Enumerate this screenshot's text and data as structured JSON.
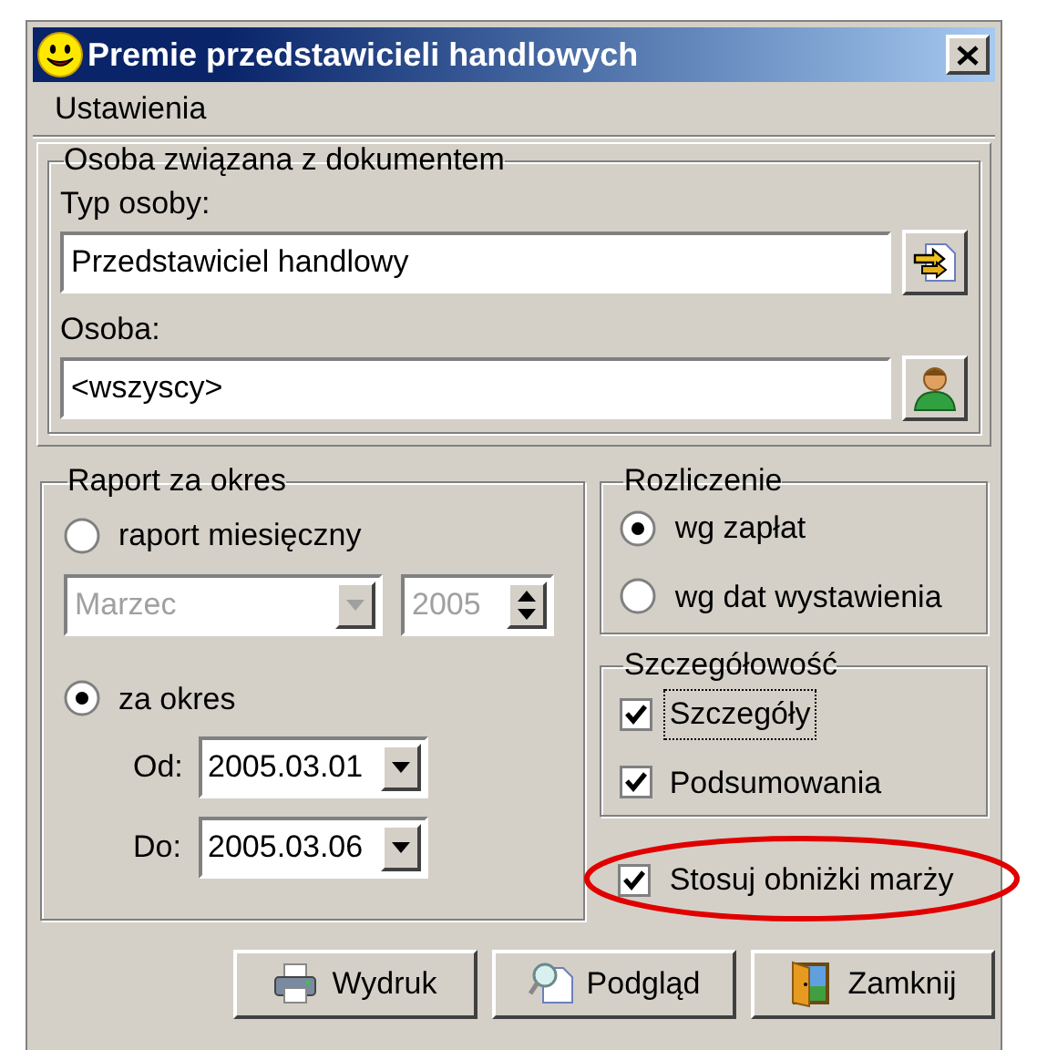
{
  "window": {
    "title": "Premie przedstawicieli handlowych"
  },
  "menu": [
    "Ustawienia"
  ],
  "person_group": {
    "title": "Osoba związana z dokumentem",
    "fields": [
      {
        "label": "Typ osoby:",
        "value": "Przedstawiciel handlowy",
        "kind": "swap"
      },
      {
        "label": "Osoba:",
        "value": "<wszyscy>",
        "kind": "person"
      }
    ]
  },
  "period_group": {
    "title": "Raport za okres",
    "options": [
      {
        "label": "raport miesięczny",
        "selected": false
      },
      {
        "label": "za okres",
        "selected": true
      }
    ],
    "month": {
      "value": "Marzec",
      "disabled": true
    },
    "year": {
      "value": "2005",
      "disabled": true
    },
    "dates": [
      {
        "label": "Od:",
        "value": "2005.03.01"
      },
      {
        "label": "Do:",
        "value": "2005.03.06"
      }
    ]
  },
  "settlement_group": {
    "title": "Rozliczenie",
    "options": [
      {
        "label": "wg zapłat",
        "selected": true
      },
      {
        "label": "wg dat wystawienia",
        "selected": false
      }
    ]
  },
  "detail_group": {
    "title": "Szczegółowość",
    "options": [
      {
        "label": "Szczegóły",
        "checked": true,
        "focused": true
      },
      {
        "label": "Podsumowania",
        "checked": true,
        "focused": false
      }
    ]
  },
  "margin_option": {
    "label": "Stosuj obniżki marży",
    "checked": true,
    "highlighted": true
  },
  "buttons": [
    {
      "label": "Wydruk",
      "kind": "print"
    },
    {
      "label": "Podgląd",
      "kind": "preview"
    },
    {
      "label": "Zamknij",
      "kind": "close"
    }
  ]
}
